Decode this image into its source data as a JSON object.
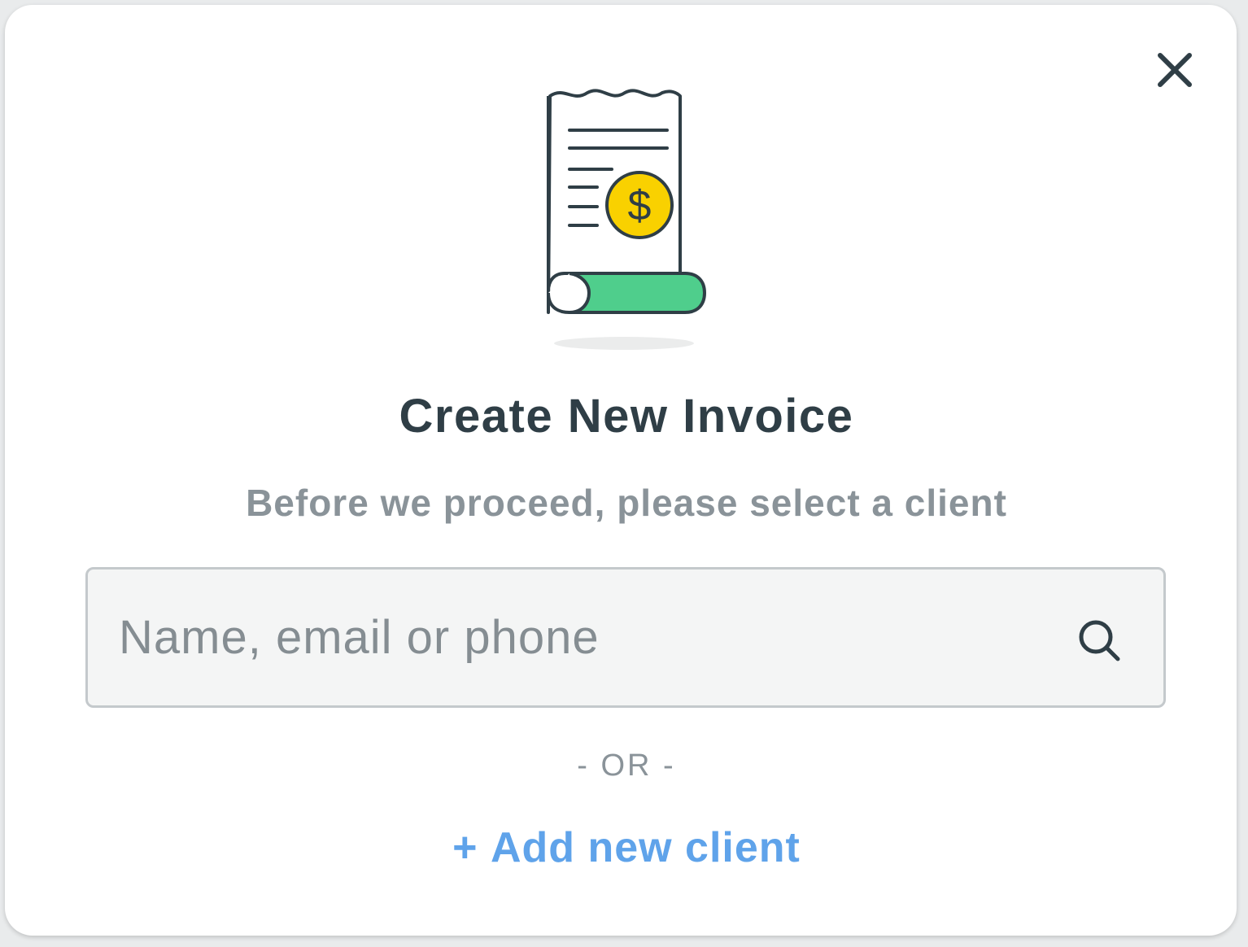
{
  "dialog": {
    "title": "Create New Invoice",
    "subtitle": "Before we proceed, please select a client",
    "close_icon": "close-icon"
  },
  "illustration": {
    "icon": "invoice-receipt-icon",
    "coin_symbol": "$",
    "colors": {
      "outline": "#2f3e46",
      "coin": "#f9d100",
      "roll": "#4fce8c"
    }
  },
  "search": {
    "value": "",
    "placeholder": "Name, email or phone",
    "icon": "search-icon"
  },
  "divider": {
    "label": "- OR -"
  },
  "add_client": {
    "plus": "+",
    "label": "Add new client"
  },
  "colors": {
    "accent": "#5fa3ea",
    "title": "#2f3e46",
    "muted": "#8a9399"
  }
}
